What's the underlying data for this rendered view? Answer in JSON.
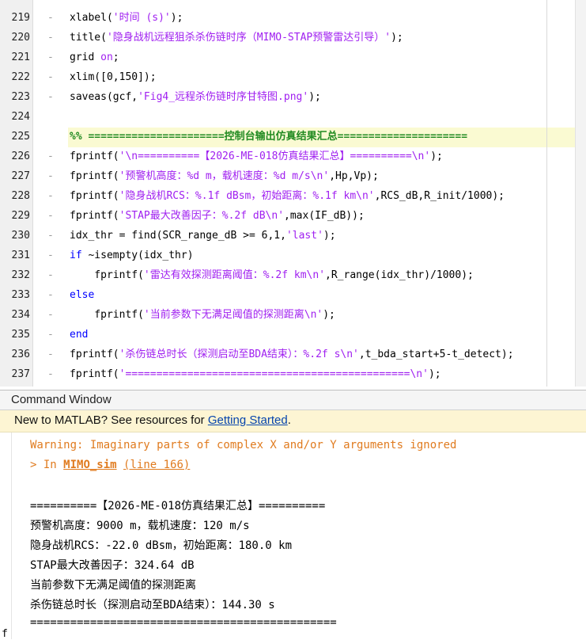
{
  "editor": {
    "lines": [
      {
        "num": "219",
        "dash": "-",
        "parts": [
          {
            "t": "xlabel(",
            "c": "code"
          },
          {
            "t": "'时间 (s)'",
            "c": "str"
          },
          {
            "t": ");",
            "c": "code"
          }
        ]
      },
      {
        "num": "220",
        "dash": "-",
        "parts": [
          {
            "t": "title(",
            "c": "code"
          },
          {
            "t": "'隐身战机远程狙杀杀伤链时序（MIMO-STAP预警雷达引导）'",
            "c": "str"
          },
          {
            "t": ");",
            "c": "code"
          }
        ]
      },
      {
        "num": "221",
        "dash": "-",
        "parts": [
          {
            "t": "grid ",
            "c": "code"
          },
          {
            "t": "on",
            "c": "str"
          },
          {
            "t": ";",
            "c": "code"
          }
        ]
      },
      {
        "num": "222",
        "dash": "-",
        "parts": [
          {
            "t": "xlim([0,150]);",
            "c": "code"
          }
        ]
      },
      {
        "num": "223",
        "dash": "-",
        "parts": [
          {
            "t": "saveas(gcf,",
            "c": "code"
          },
          {
            "t": "'Fig4_远程杀伤链时序甘特图.png'",
            "c": "str"
          },
          {
            "t": ");",
            "c": "code"
          }
        ]
      },
      {
        "num": "224",
        "dash": "",
        "parts": []
      },
      {
        "num": "225",
        "dash": "",
        "parts": [
          {
            "t": "%% ======================控制台输出仿真结果汇总=====================",
            "c": "cmt"
          }
        ]
      },
      {
        "num": "226",
        "dash": "-",
        "parts": [
          {
            "t": "fprintf(",
            "c": "code"
          },
          {
            "t": "'\\n==========【2026-ME-018仿真结果汇总】==========\\n'",
            "c": "str"
          },
          {
            "t": ");",
            "c": "code"
          }
        ]
      },
      {
        "num": "227",
        "dash": "-",
        "parts": [
          {
            "t": "fprintf(",
            "c": "code"
          },
          {
            "t": "'预警机高度：%d m，载机速度：%d m/s\\n'",
            "c": "str"
          },
          {
            "t": ",Hp,Vp);",
            "c": "code"
          }
        ]
      },
      {
        "num": "228",
        "dash": "-",
        "parts": [
          {
            "t": "fprintf(",
            "c": "code"
          },
          {
            "t": "'隐身战机RCS：%.1f dBsm，初始距离：%.1f km\\n'",
            "c": "str"
          },
          {
            "t": ",RCS_dB,R_init/1000);",
            "c": "code"
          }
        ]
      },
      {
        "num": "229",
        "dash": "-",
        "parts": [
          {
            "t": "fprintf(",
            "c": "code"
          },
          {
            "t": "'STAP最大改善因子：%.2f dB\\n'",
            "c": "str"
          },
          {
            "t": ",max(IF_dB));",
            "c": "code"
          }
        ]
      },
      {
        "num": "230",
        "dash": "-",
        "parts": [
          {
            "t": "idx_thr = find(SCR_range_dB >= 6,1,",
            "c": "code"
          },
          {
            "t": "'last'",
            "c": "str"
          },
          {
            "t": ");",
            "c": "code"
          }
        ]
      },
      {
        "num": "231",
        "dash": "-",
        "parts": [
          {
            "t": "if",
            "c": "kw"
          },
          {
            "t": " ~isempty(idx_thr)",
            "c": "code"
          }
        ]
      },
      {
        "num": "232",
        "dash": "-",
        "parts": [
          {
            "t": "    fprintf(",
            "c": "code"
          },
          {
            "t": "'雷达有效探测距离阈值：%.2f km\\n'",
            "c": "str"
          },
          {
            "t": ",R_range(idx_thr)/1000);",
            "c": "code"
          }
        ]
      },
      {
        "num": "233",
        "dash": "-",
        "parts": [
          {
            "t": "else",
            "c": "kw"
          }
        ]
      },
      {
        "num": "234",
        "dash": "-",
        "parts": [
          {
            "t": "    fprintf(",
            "c": "code"
          },
          {
            "t": "'当前参数下无满足阈值的探测距离\\n'",
            "c": "str"
          },
          {
            "t": ");",
            "c": "code"
          }
        ]
      },
      {
        "num": "235",
        "dash": "-",
        "parts": [
          {
            "t": "end",
            "c": "kw"
          }
        ]
      },
      {
        "num": "236",
        "dash": "-",
        "parts": [
          {
            "t": "fprintf(",
            "c": "code"
          },
          {
            "t": "'杀伤链总时长（探测启动至BDA结束）：%.2f s\\n'",
            "c": "str"
          },
          {
            "t": ",t_bda_start+5-t_detect);",
            "c": "code"
          }
        ]
      },
      {
        "num": "237",
        "dash": "-",
        "parts": [
          {
            "t": "fprintf(",
            "c": "code"
          },
          {
            "t": "'==============================================\\n'",
            "c": "str"
          },
          {
            "t": ");",
            "c": "code"
          }
        ]
      }
    ]
  },
  "command_window": {
    "title": "Command Window",
    "banner_prefix": "New to MATLAB? See resources for ",
    "banner_link": "Getting Started",
    "banner_suffix": ".",
    "warning": "Warning: Imaginary parts of complex X and/or Y arguments ignored",
    "warn_in": "> In ",
    "warn_func": "MIMO_sim",
    "warn_line": "(line 166)",
    "output": [
      "==========【2026-ME-018仿真结果汇总】==========",
      "预警机高度：9000 m，载机速度：120 m/s",
      "隐身战机RCS：-22.0 dBsm，初始距离：180.0 km",
      "STAP最大改善因子：324.64 dB",
      "当前参数下无满足阈值的探测距离",
      "杀伤链总时长（探测启动至BDA结束）：144.30 s",
      "=============================================="
    ]
  },
  "colors": {
    "keyword": "#0000ff",
    "string": "#a020f0",
    "comment": "#228b22",
    "warning": "#e07b1f"
  }
}
